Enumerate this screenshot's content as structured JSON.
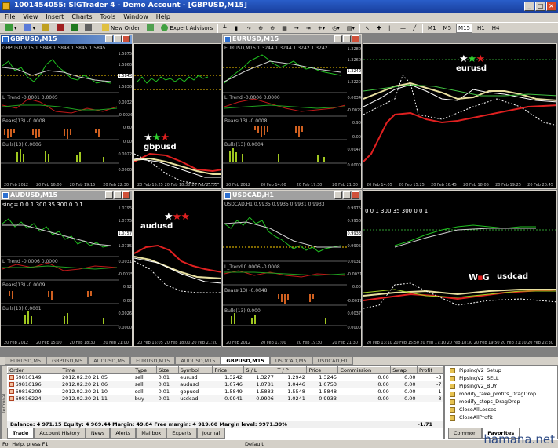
{
  "app": {
    "title": "1001454055: SIGTrader 4 - Demo Account - [GBPUSD,M15]"
  },
  "menu": [
    "File",
    "View",
    "Insert",
    "Charts",
    "Tools",
    "Window",
    "Help"
  ],
  "toolbar": {
    "new_order": "New Order",
    "expert_advisors": "Expert Advisors",
    "timeframes": [
      "M1",
      "M5",
      "M15",
      "H1",
      "H4"
    ]
  },
  "charts": [
    {
      "title": "GBPUSD,M15",
      "header": "GBPUSD,M15  1.5848 1.5848 1.5845 1.5845",
      "scale": [
        "1.5875",
        "1.5860",
        "1.5845",
        "1.5830",
        "0.0032",
        "-0.0026",
        "0.60",
        "0.00",
        "0.0022",
        "0.0000"
      ],
      "trend": "L_Trend -0.0001 0.0005",
      "bears": "Bears(13) -0.0008",
      "bulls": "Bulls(13) 0.0006",
      "times": [
        "20 Feb 2012",
        "20 Feb 16:00",
        "20 Feb 19:15",
        "20 Feb 22:30"
      ]
    },
    {
      "tag": "gbpusd",
      "times": [
        "20 Feb 15:25",
        "20 Feb 18:30",
        "20 Feb 21:05"
      ]
    },
    {
      "title": "EURUSD,M15",
      "header": "EURUSD,M15  1.3244 1.3244 1.3242 1.3242",
      "scale": [
        "1.3280",
        "1.3260",
        "1.3242",
        "1.3220",
        "0.0034",
        "-0.0029",
        "0.90",
        "0.00",
        "0.0047",
        "0.0000"
      ],
      "trend": "L_Trend -0.0006 0.0000",
      "bears": "Bears(13) -0.0008",
      "bulls": "Bulls(13) 0.0004",
      "times": [
        "20 Feb 2012",
        "20 Feb 14:00",
        "20 Feb 17:30",
        "20 Feb 21:30"
      ]
    },
    {
      "tag": "eurusd",
      "times": [
        "20 Feb 14:05",
        "20 Feb 15:25",
        "20 Feb 16:45",
        "20 Feb 18:05",
        "20 Feb 19:25",
        "20 Feb 20:45"
      ]
    },
    {
      "title": "AUDUSD,M15",
      "header": "sing= 0 0 1   300 35 300 0 0 1",
      "scale": [
        "1.0795",
        "1.0775",
        "1.0757",
        "1.0735",
        "0.0031",
        "-0.0035",
        "0.92",
        "0.00",
        "0.0026",
        "0.0000"
      ],
      "trend": "L_Trend -0.0006 0.0000",
      "bears": "Bears(13) -0.0009",
      "bulls": "Bulls(13) 0.0001",
      "times": [
        "20 Feb 2012",
        "20 Feb 15:00",
        "20 Feb 18:30",
        "20 Feb 21:00"
      ]
    },
    {
      "tag": "audusd",
      "times": [
        "20 Feb 15:05",
        "20 Feb 18:00",
        "20 Feb 21:20"
      ]
    },
    {
      "title": "USDCAD,H1",
      "header": "USDCAD,H1  0.9935 0.9935 0.9931 0.9933",
      "scale": [
        "0.9975",
        "0.9950",
        "0.9933",
        "0.9905",
        "0.0031",
        "-0.0031",
        "0.00",
        "-0.0017",
        "0.0037",
        "0.0000"
      ],
      "trend": "L_Trend 0.0006 -0.0008",
      "bears": "Bears(13) -0.0048",
      "bulls": "Bulls(13) 0.000",
      "times": [
        "20 Feb 2012",
        "20 Feb 17:00",
        "20 Feb 19:30",
        "20 Feb 21:30"
      ]
    },
    {
      "tag": "usdcad",
      "header": "0 0 1   300 35 300 0 0 1",
      "times": [
        "20 Feb 13:10",
        "20 Feb 15:50",
        "20 Feb 17:10",
        "20 Feb 18:30",
        "20 Feb 19:50",
        "20 Feb 21:10",
        "20 Feb 22:30"
      ]
    }
  ],
  "chart_tabs": [
    "EURUSD,M5",
    "GBPUSD,M5",
    "AUDUSD,M5",
    "EURUSD,M15",
    "AUDUSD,M15",
    "GBPUSD,M15",
    "USDCAD,M5",
    "USDCAD,H1"
  ],
  "active_chart_tab": "GBPUSD,M15",
  "terminal": {
    "columns": [
      "Order",
      "Time",
      "Type",
      "Size",
      "Symbol",
      "Price",
      "S / L",
      "T / P",
      "Price",
      "Commission",
      "Swap",
      "Profit"
    ],
    "rows": [
      [
        "69816149",
        "2012.02.20 21:05",
        "sell",
        "0.01",
        "eurusd",
        "1.3242",
        "1.3277",
        "1.2942",
        "1.3245",
        "0.00",
        "0.00",
        "-3"
      ],
      [
        "69816196",
        "2012.02.20 21:06",
        "sell",
        "0.01",
        "audusd",
        "1.0746",
        "1.0781",
        "1.0446",
        "1.0753",
        "0.00",
        "0.00",
        "-7"
      ],
      [
        "69816209",
        "2012.02.20 21:10",
        "sell",
        "0.01",
        "gbpusd",
        "1.5849",
        "1.5883",
        "1.5548",
        "1.5848",
        "0.00",
        "0.00",
        "1"
      ],
      [
        "69816224",
        "2012.02.20 21:11",
        "buy",
        "0.01",
        "usdcad",
        "0.9941",
        "0.9906",
        "1.0241",
        "0.9933",
        "0.00",
        "0.00",
        "-8"
      ]
    ],
    "balance": "Balance: 4 971.15  Equity: 4 969.44  Margin: 49.84  Free margin: 4 919.60  Margin level: 9971.39%",
    "total_profit": "-1.71",
    "tabs": [
      "Trade",
      "Account History",
      "News",
      "Alerts",
      "Mailbox",
      "Experts",
      "Journal"
    ],
    "side_label": "Terminal"
  },
  "navigator": {
    "items": [
      "PipsingV2_Setup",
      "PipsingV2_SELL",
      "PipsingV2_BUY",
      "modify_take_profits_DragDrop",
      "modify_stops_DragDrop",
      "CloseAllLosses",
      "CloseAllProfit"
    ],
    "tabs": [
      "Common",
      "Favorites"
    ]
  },
  "status": {
    "help": "For Help, press F1",
    "profile": "Default"
  },
  "watermark": "hamana.net"
}
